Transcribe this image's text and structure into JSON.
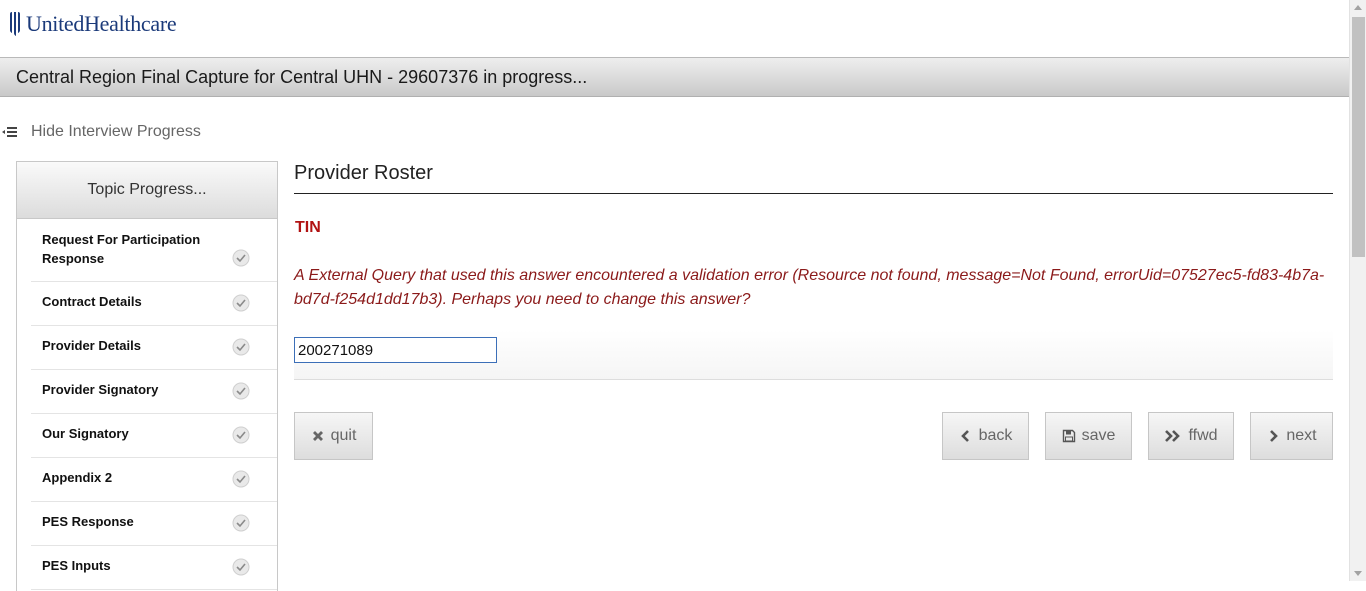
{
  "brand": {
    "name": "UnitedHealthcare",
    "logo_color": "#1b3a7a"
  },
  "title_bar": {
    "title": "Central Region Final Capture for Central UHN - 29607376 in progress..."
  },
  "progress_toggle": {
    "label": "Hide Interview Progress",
    "icon": "menu-icon"
  },
  "topic_panel": {
    "header": "Topic Progress...",
    "items": [
      {
        "label": "Request For Participation Response",
        "status": "complete"
      },
      {
        "label": "Contract Details",
        "status": "complete"
      },
      {
        "label": "Provider Details",
        "status": "complete"
      },
      {
        "label": "Provider Signatory",
        "status": "complete"
      },
      {
        "label": "Our Signatory",
        "status": "complete"
      },
      {
        "label": "Appendix 2",
        "status": "complete"
      },
      {
        "label": "PES Response",
        "status": "complete"
      },
      {
        "label": "PES Inputs",
        "status": "complete"
      }
    ]
  },
  "main": {
    "section_title": "Provider Roster",
    "field_label": "TIN",
    "error_message": "A External Query that used this answer encountered a validation error (Resource not found, message=Not Found, errorUid=07527ec5-fd83-4b7a-bd7d-f254d1dd17b3). Perhaps you need to change this answer?",
    "tin_value": "200271089",
    "colors": {
      "error": "#8b1a1a",
      "label": "#b11212",
      "input_border": "#3c6fb8"
    }
  },
  "buttons": {
    "quit": {
      "label": "quit",
      "icon": "close-icon"
    },
    "back": {
      "label": "back",
      "icon": "chevron-left-icon"
    },
    "save": {
      "label": "save",
      "icon": "floppy-icon"
    },
    "ffwd": {
      "label": "ffwd",
      "icon": "double-chevron-right-icon"
    },
    "next": {
      "label": "next",
      "icon": "chevron-right-icon"
    }
  }
}
